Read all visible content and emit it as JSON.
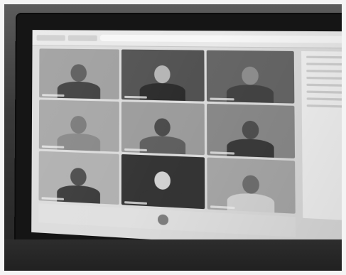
{
  "image": {
    "tiles": [
      {
        "name": "top-left",
        "tone": "#9f9f9f",
        "head": "#5c5c5c",
        "shoulders": "#3f3f3f"
      },
      {
        "name": "top-middle",
        "tone": "#525252",
        "head": "#b5b5b5",
        "shoulders": "#2c2c2c"
      },
      {
        "name": "top-right",
        "tone": "#666666",
        "head": "#8f8f8f",
        "shoulders": "#444444"
      },
      {
        "name": "middle-left",
        "tone": "#a6a6a6",
        "head": "#7a7a7a",
        "shoulders": "#888888"
      },
      {
        "name": "middle-middle",
        "tone": "#9c9c9c",
        "head": "#4c4c4c",
        "shoulders": "#606060"
      },
      {
        "name": "middle-right",
        "tone": "#8a8a8a",
        "head": "#505050",
        "shoulders": "#3b3b3b"
      },
      {
        "name": "bottom-left",
        "tone": "#b0b0b0",
        "head": "#4d4d4d",
        "shoulders": "#3b3b3b"
      },
      {
        "name": "bottom-middle",
        "tone": "#353535",
        "head": "#d2d2d2",
        "shoulders": "#353535"
      },
      {
        "name": "bottom-right",
        "tone": "#a8a8a8",
        "head": "#707070",
        "shoulders": "#d5d5d5"
      }
    ]
  }
}
